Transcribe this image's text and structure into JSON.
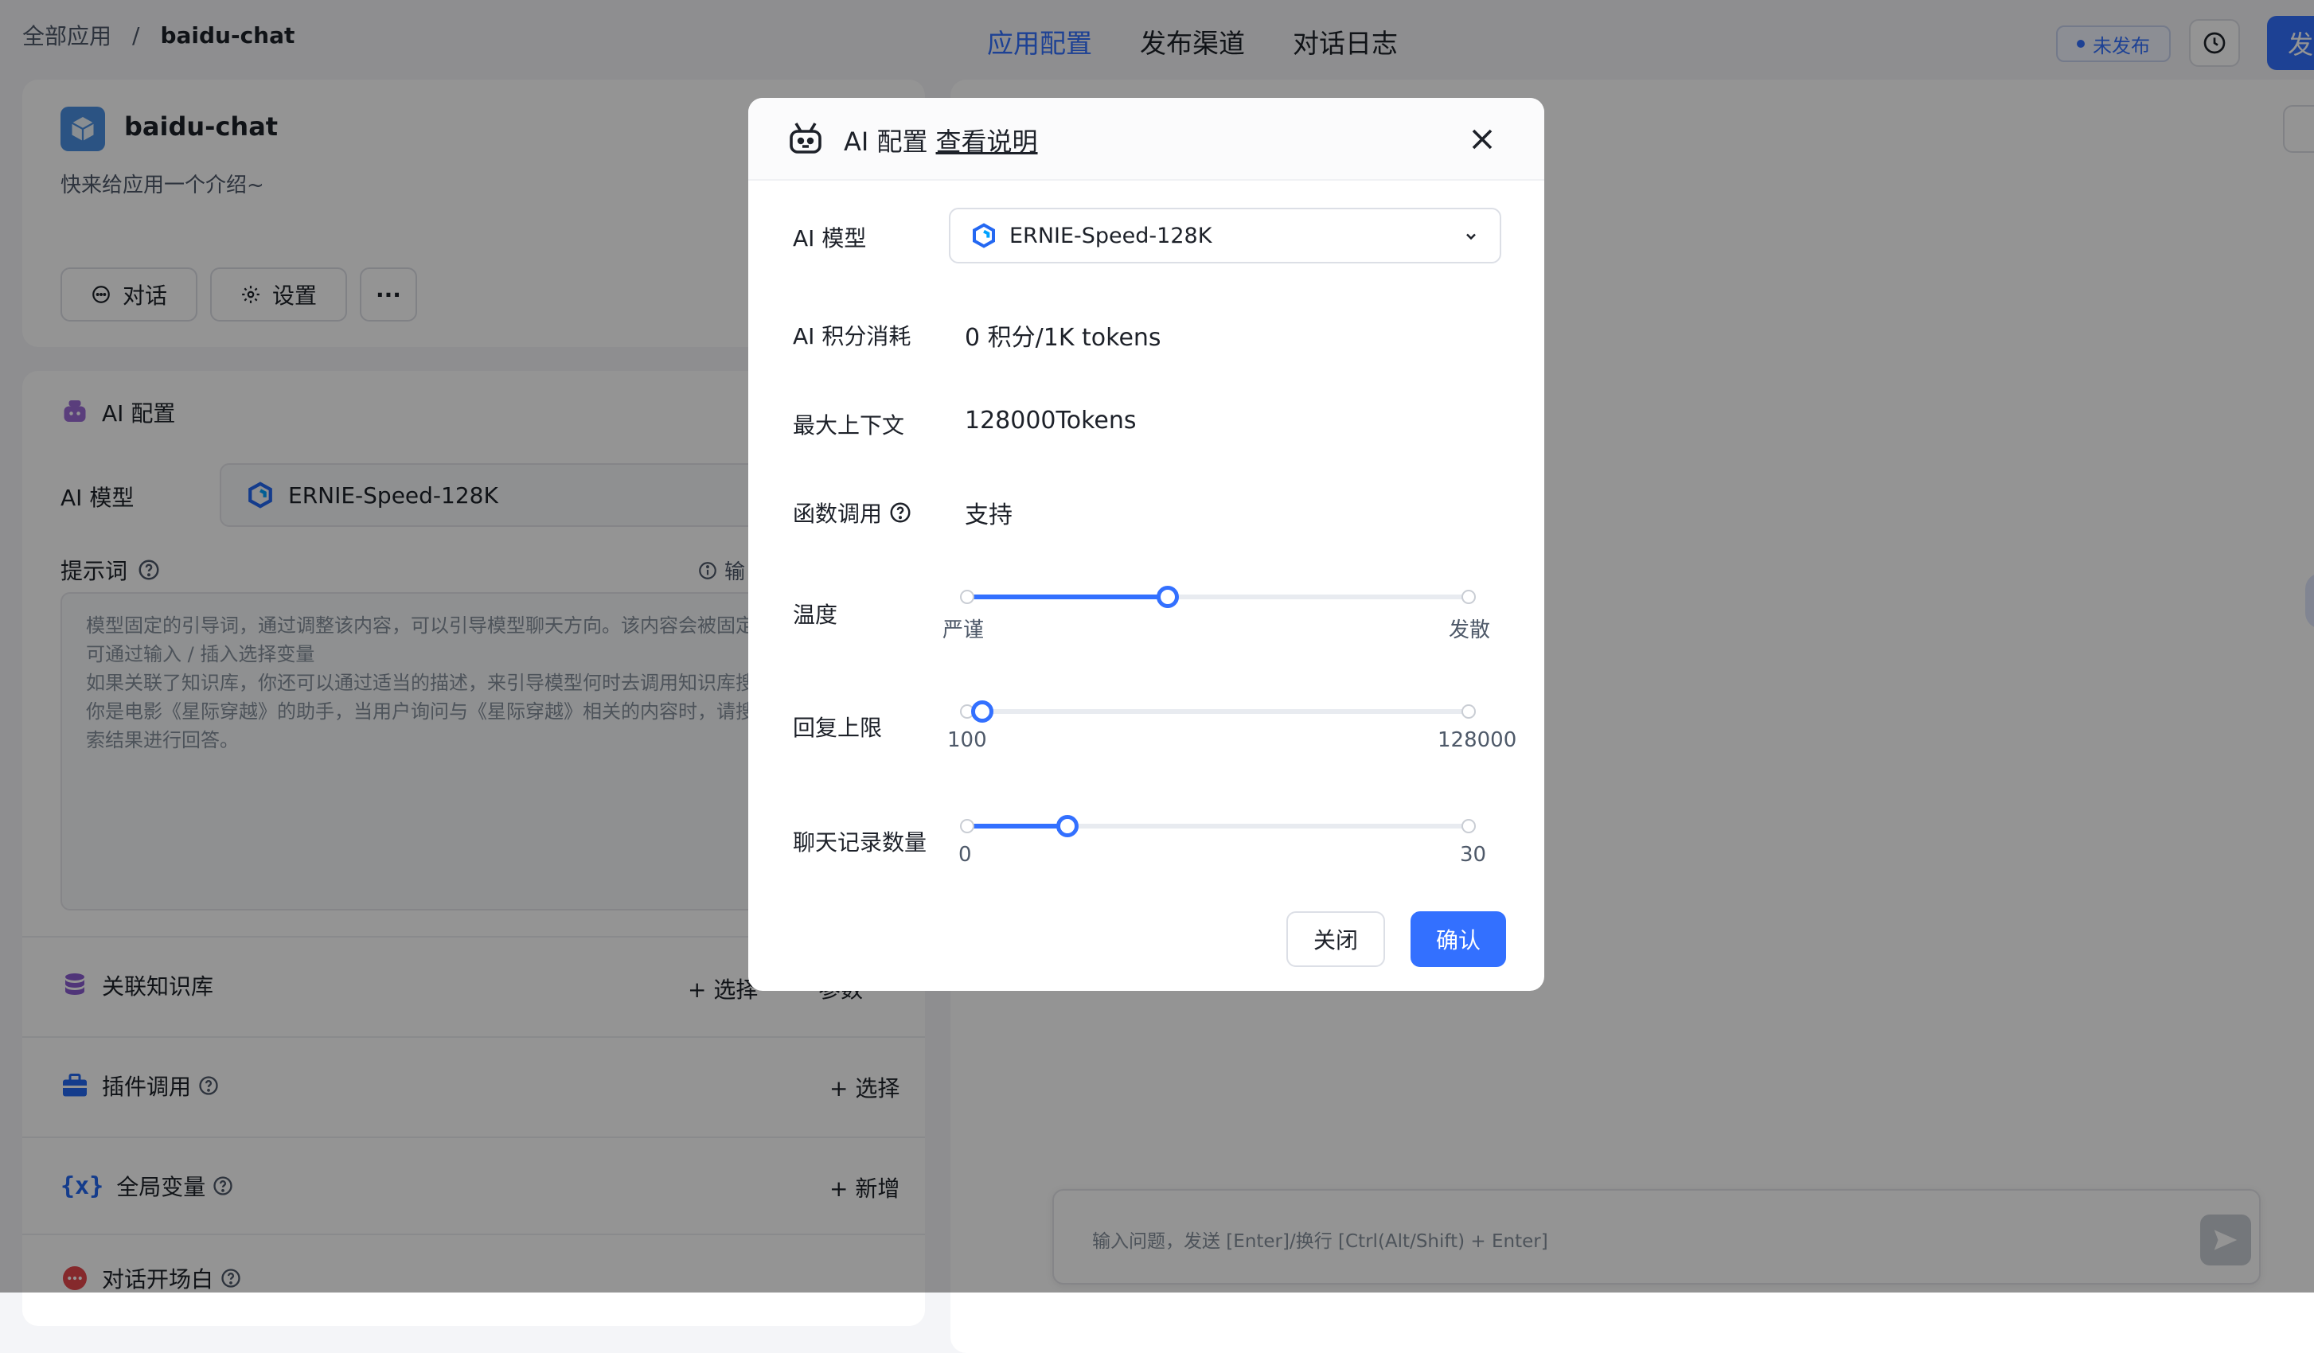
{
  "breadcrumb": {
    "root": "全部应用",
    "separator": "/",
    "current": "baidu-chat"
  },
  "top_tabs": [
    {
      "label": "应用配置",
      "active": true
    },
    {
      "label": "发布渠道",
      "active": false
    },
    {
      "label": "对话日志",
      "active": false
    }
  ],
  "status_badge": "未发布",
  "publish_label": "发",
  "app": {
    "name": "baidu-chat",
    "description": "快来给应用一个介绍~",
    "chat_btn": "对话",
    "settings_btn": "设置",
    "more_btn": "···"
  },
  "config": {
    "title": "AI 配置",
    "model_label": "AI 模型",
    "model_value": "ERNIE-Speed-128K",
    "prompt_label": "提示词",
    "prompt_hint": "输",
    "prompt_placeholder": "模型固定的引导词，通过调整该内容，可以引导模型聊天方向。该内容会被固定在上下文的开头。可通过输入 / 插入选择变量\n如果关联了知识库，你还可以通过适当的描述，来引导模型何时去调用知识库搜索。例如：\n你是电影《星际穿越》的助手，当用户询问与《星际穿越》相关的内容时，请搜索知识库并结合搜索结果进行回答。",
    "kb_label": "关联知识库",
    "kb_select": "+ 选择",
    "kb_params": "参数",
    "plugin_label": "插件调用",
    "plugin_select": "+ 选择",
    "var_label": "全局变量",
    "var_add": "+ 新增",
    "opener_label": "对话开场白"
  },
  "chat": {
    "placeholder": "输入问题，发送 [Enter]/换行 [Ctrl(Alt/Shift) + Enter]"
  },
  "modal": {
    "title": "AI 配置",
    "doc_link": "查看说明",
    "model_label": "AI 模型",
    "model_value": "ERNIE-Speed-128K",
    "points_label": "AI 积分消耗",
    "points_value": "0 积分/1K tokens",
    "context_label": "最大上下文",
    "context_value": "128000Tokens",
    "func_label": "函数调用",
    "func_value": "支持",
    "temperature": {
      "label": "温度",
      "min_label": "严谨",
      "max_label": "发散",
      "fraction": 0.4
    },
    "max_reply": {
      "label": "回复上限",
      "min_label": "100",
      "max_label": "128000",
      "fraction": 0.03
    },
    "history": {
      "label": "聊天记录数量",
      "min_label": "0",
      "max_label": "30",
      "fraction": 0.2
    },
    "close_btn": "关闭",
    "confirm_btn": "确认"
  },
  "colors": {
    "primary": "#3370ff",
    "overlay": "rgba(0,0,0,0.42)"
  }
}
